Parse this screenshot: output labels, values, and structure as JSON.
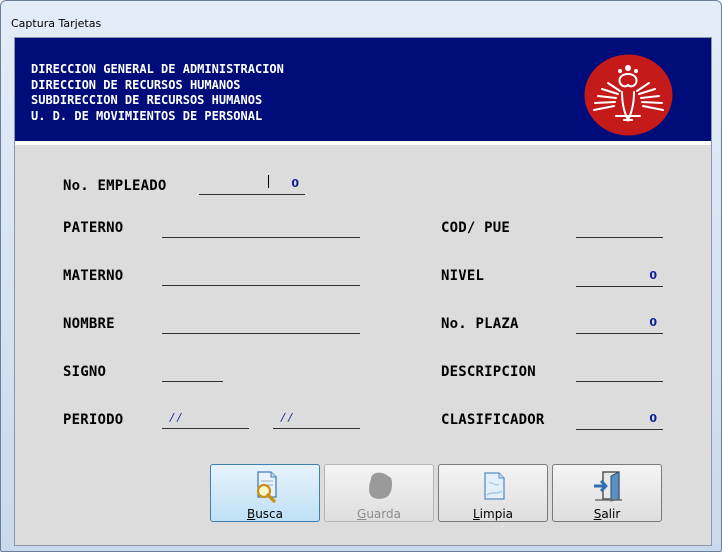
{
  "window": {
    "title": "Captura Tarjetas"
  },
  "banner": {
    "lines": [
      "DIRECCION GENERAL DE ADMINISTRACION",
      "DIRECCION DE RECURSOS HUMANOS",
      "SUBDIRECCION DE RECURSOS HUMANOS",
      "U. D. DE MOVIMIENTOS DE PERSONAL"
    ],
    "color": "#000c7a",
    "logo_color": "#c41a1a"
  },
  "form": {
    "empleado_label": "No. EMPLEADO",
    "empleado_value": "0",
    "paterno_label": "PATERNO",
    "paterno_value": "",
    "materno_label": "MATERNO",
    "materno_value": "",
    "nombre_label": "NOMBRE",
    "nombre_value": "",
    "signo_label": "SIGNO",
    "signo_value": "",
    "periodo_label": "PERIODO",
    "periodo_from": "/ /",
    "periodo_to": "/ /",
    "codpue_label": "COD/ PUE",
    "codpue_value": "",
    "nivel_label": "NIVEL",
    "nivel_value": "0",
    "plaza_label": "No. PLAZA",
    "plaza_value": "0",
    "descripcion_label": "DESCRIPCION",
    "descripcion_value": "",
    "clasificador_label": "CLASIFICADOR",
    "clasificador_value": "0"
  },
  "buttons": {
    "busca": {
      "mnemonic": "B",
      "rest": "usca",
      "icon": "search-document-icon"
    },
    "guarda": {
      "mnemonic": "G",
      "rest": "uarda",
      "icon": "save-icon"
    },
    "limpia": {
      "mnemonic": "L",
      "rest": "impia",
      "icon": "clear-document-icon"
    },
    "salir": {
      "mnemonic": "S",
      "rest": "alir",
      "icon": "exit-door-icon"
    }
  }
}
